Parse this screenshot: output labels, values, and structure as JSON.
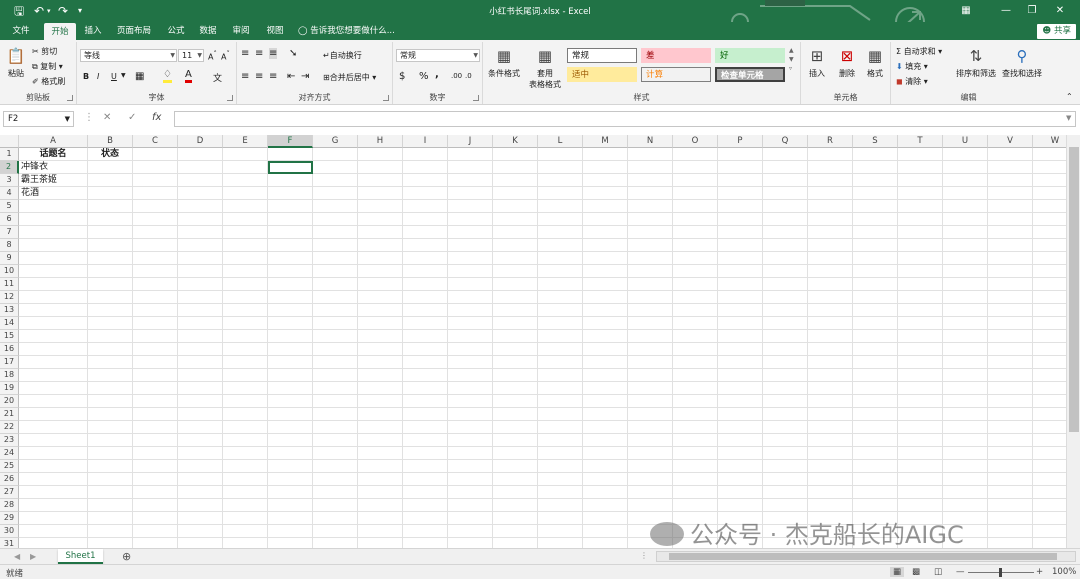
{
  "window": {
    "title": "小红书长尾词.xlsx - Excel"
  },
  "quick_access": {
    "save_icon": "save-icon",
    "undo_icon": "undo-icon",
    "redo_icon": "redo-icon"
  },
  "tabs": [
    "文件",
    "开始",
    "插入",
    "页面布局",
    "公式",
    "数据",
    "审阅",
    "视图"
  ],
  "tell_me": "告诉我您想要做什么...",
  "share": "共享",
  "ribbon": {
    "clipboard": {
      "paste": "粘贴",
      "cut": "剪切",
      "copy": "复制",
      "format_painter": "格式刷",
      "label": "剪贴板"
    },
    "font": {
      "name": "等线",
      "size": "11",
      "bold": "B",
      "italic": "I",
      "underline": "U",
      "label": "字体"
    },
    "alignment": {
      "wrap": "自动换行",
      "merge": "合并后居中",
      "label": "对齐方式"
    },
    "number": {
      "format": "常规",
      "currency": "$",
      "percent": "%",
      "comma": ",",
      "label": "数字"
    },
    "styles": {
      "conditional": "条件格式",
      "table1": "套用",
      "table2": "表格格式",
      "cells": [
        "常规",
        "差",
        "好",
        "适中",
        "计算",
        "检查单元格"
      ],
      "label": "样式"
    },
    "cells": {
      "insert": "插入",
      "delete": "删除",
      "format": "格式",
      "label": "单元格"
    },
    "editing": {
      "autosum": "自动求和",
      "fill": "填充",
      "clear": "清除",
      "sort": "排序和筛选",
      "find": "查找和选择",
      "label": "编辑"
    }
  },
  "formula_bar": {
    "name_box": "F2",
    "fx": "fx",
    "cancel": "✕",
    "enter": "✓",
    "content": ""
  },
  "columns": [
    "A",
    "B",
    "C",
    "D",
    "E",
    "F",
    "G",
    "H",
    "I",
    "J",
    "K",
    "L",
    "M",
    "N",
    "O",
    "P",
    "Q",
    "R",
    "S",
    "T",
    "U",
    "V",
    "W"
  ],
  "selected": {
    "col": "F",
    "row": "2"
  },
  "rows": [
    "1",
    "2",
    "3",
    "4",
    "5",
    "6",
    "7",
    "8",
    "9",
    "10",
    "11",
    "12",
    "13",
    "14",
    "15",
    "16",
    "17",
    "18",
    "19",
    "20",
    "21",
    "22",
    "23",
    "24",
    "25",
    "26",
    "27",
    "28",
    "29",
    "30",
    "31"
  ],
  "cells": {
    "A1": "话题名",
    "B1": "状态",
    "A2": "冲锋衣",
    "A3": "霸王茶姬",
    "A4": "花酒"
  },
  "sheets": [
    "Sheet1"
  ],
  "status": {
    "ready": "就绪",
    "zoom": "100%"
  },
  "watermark": "公众号 · 杰克船长的AIGC"
}
